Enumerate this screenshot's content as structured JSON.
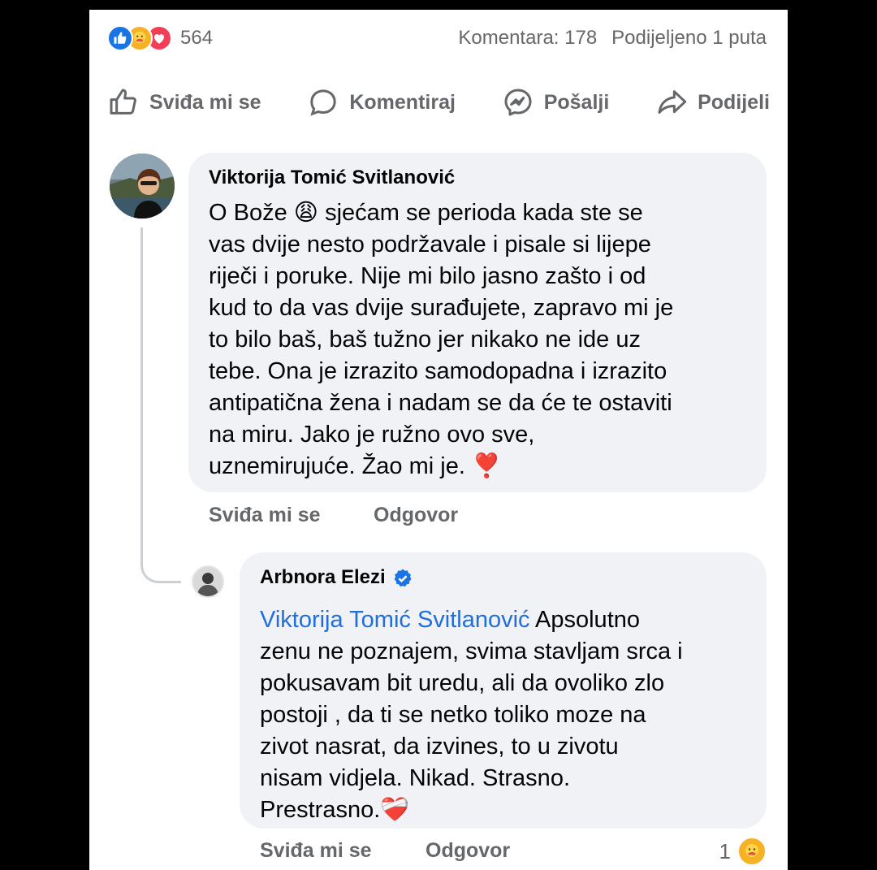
{
  "post": {
    "reaction_count": "564",
    "reaction_icons": [
      "like-icon",
      "care-icon",
      "love-icon"
    ],
    "comments_label": "Komentara: 178",
    "shares_label": "Podijeljeno 1 puta"
  },
  "actions": {
    "like": "Sviđa mi se",
    "comment": "Komentiraj",
    "send": "Pošalji",
    "share": "Podijeli"
  },
  "comment1": {
    "author": "Viktorija Tomić Svitlanović",
    "text_before_emoji": "O Bože ",
    "emoji": "😩",
    "text": " sjećam se perioda kada ste se\nvas dvije nesto podržavale i pisale si lijepe\nriječi i poruke. Nije mi bilo jasno zašto i od\nkud to da vas dvije surađujete, zapravo mi je\nto bilo baš, baš tužno jer nikako ne ide uz\ntebe. Ona je izrazito samodopadna i izrazito\nantipatična žena i nadam se da će te ostaviti\nna miru. Jako je ružno ovo sve,\nuznemirujuće. Žao mi je. ",
    "end_emoji": "❣️",
    "like_label": "Sviđa mi se",
    "reply_label": "Odgovor"
  },
  "comment2": {
    "author": "Arbnora Elezi",
    "mention": "Viktorija Tomić Svitlanović",
    "text": " Apsolutno\nzenu ne poznajem, svima stavljam srca i\npokusavam bit uredu, ali da ovoliko zlo\npostoji , da ti se netko toliko moze na\nzivot nasrat, da izvines, to u zivotu\nnisam vidjela. Nikad. Strasno.\nPrestrasno.",
    "end_emoji": "❤️‍🩹",
    "like_label": "Sviđa mi se",
    "reply_label": "Odgovor",
    "reaction_count": "1"
  },
  "colors": {
    "accent": "#1b74e4",
    "mention": "#216fdb",
    "muted": "#65676b",
    "bubble": "#f0f2f5"
  }
}
